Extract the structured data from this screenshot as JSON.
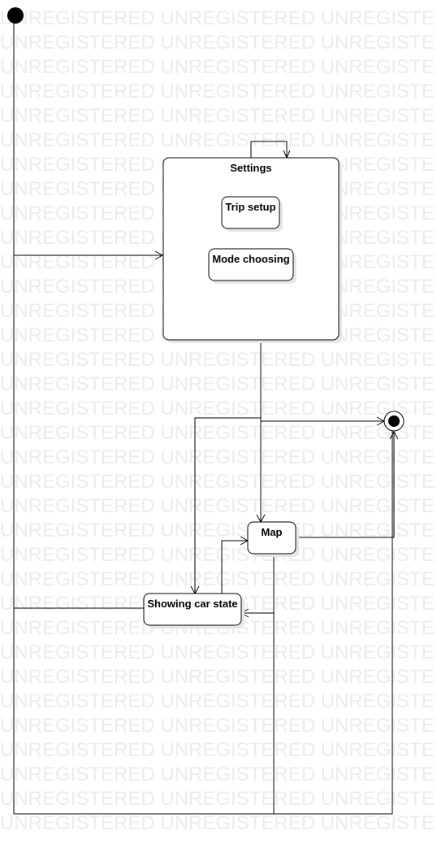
{
  "watermark": {
    "text": "UNREGISTERED UNREGISTERED UNREGISTE",
    "color": "#ececec"
  },
  "diagram": {
    "states": {
      "settings": "Settings",
      "trip_setup": "Trip setup",
      "mode_choosing": "Mode choosing",
      "map": "Map",
      "showing_car_state": "Showing car state"
    }
  }
}
